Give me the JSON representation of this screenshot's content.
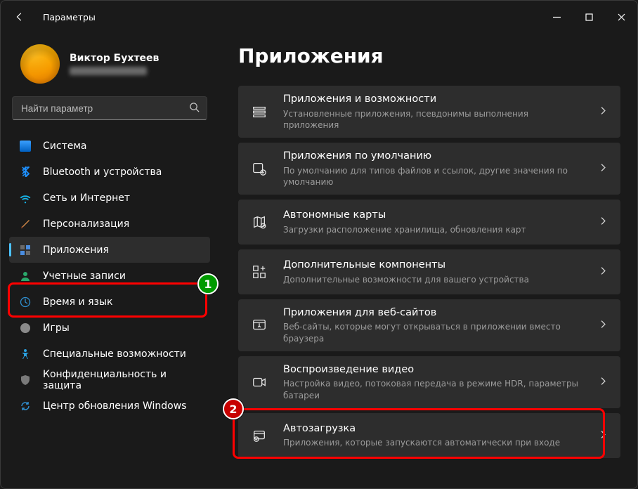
{
  "window": {
    "title": "Параметры"
  },
  "user": {
    "name": "Виктор Бухтеев"
  },
  "search": {
    "placeholder": "Найти параметр"
  },
  "sidebar": {
    "items": [
      {
        "label": "Система",
        "icon": "system-icon"
      },
      {
        "label": "Bluetooth и устройства",
        "icon": "bluetooth-icon"
      },
      {
        "label": "Сеть и Интернет",
        "icon": "network-icon"
      },
      {
        "label": "Персонализация",
        "icon": "personalization-icon"
      },
      {
        "label": "Приложения",
        "icon": "apps-icon",
        "selected": true
      },
      {
        "label": "Учетные записи",
        "icon": "accounts-icon"
      },
      {
        "label": "Время и язык",
        "icon": "time-language-icon"
      },
      {
        "label": "Игры",
        "icon": "gaming-icon"
      },
      {
        "label": "Специальные возможности",
        "icon": "accessibility-icon"
      },
      {
        "label": "Конфиденциальность и защита",
        "icon": "privacy-icon"
      },
      {
        "label": "Центр обновления Windows",
        "icon": "windows-update-icon"
      }
    ]
  },
  "page": {
    "title": "Приложения"
  },
  "tiles": [
    {
      "title": "Приложения и возможности",
      "sub": "Установленные приложения, псевдонимы выполнения приложения",
      "icon": "apps-features-icon"
    },
    {
      "title": "Приложения по умолчанию",
      "sub": "По умолчанию для типов файлов и ссылок, другие значения по умолчанию",
      "icon": "default-apps-icon"
    },
    {
      "title": "Автономные карты",
      "sub": "Загрузки расположение хранилища, обновления карт",
      "icon": "offline-maps-icon"
    },
    {
      "title": "Дополнительные компоненты",
      "sub": "Дополнительные возможности для вашего устройства",
      "icon": "optional-features-icon"
    },
    {
      "title": "Приложения для веб-сайтов",
      "sub": "Веб-сайты, которые могут открываться в приложении вместо браузера",
      "icon": "apps-websites-icon"
    },
    {
      "title": "Воспроизведение видео",
      "sub": "Настройка видео, потоковая передача в режиме HDR, параметры батареи",
      "icon": "video-playback-icon"
    },
    {
      "title": "Автозагрузка",
      "sub": "Приложения, которые запускаются автоматически при входе",
      "icon": "startup-icon"
    }
  ],
  "annotations": {
    "badge1": "1",
    "badge2": "2"
  }
}
